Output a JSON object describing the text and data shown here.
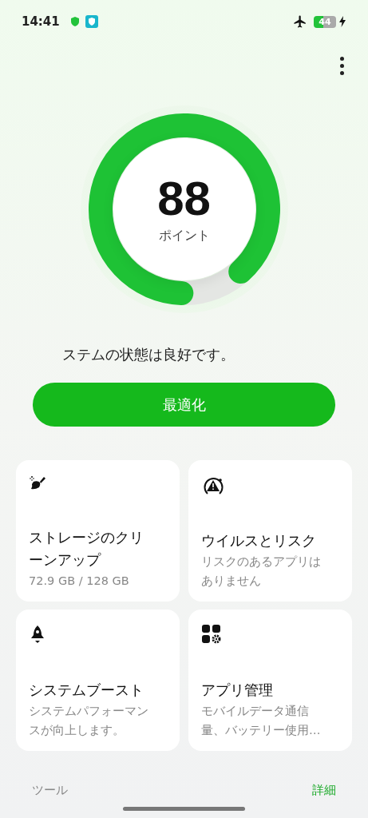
{
  "status_bar": {
    "time": "14:41",
    "battery": "44"
  },
  "score": {
    "value": "88",
    "unit": "ポイント"
  },
  "status_message": "ステムの状態は良好です。",
  "optimize_button": "最適化",
  "cards": [
    {
      "kind": "broom",
      "title": "ストレージのクリーンアップ",
      "subtitle": "72.9 GB / 128 GB"
    },
    {
      "kind": "warning",
      "title": "ウイルスとリスク",
      "subtitle": "リスクのあるアプリはありません"
    },
    {
      "kind": "rocket",
      "title": "システムブースト",
      "subtitle": "システムパフォーマンスが向上します。"
    },
    {
      "kind": "apps",
      "title": "アプリ管理",
      "subtitle": "モバイルデータ通信量、バッテリー使用…"
    }
  ],
  "tabs": [
    {
      "label": "ツール",
      "selected": false
    },
    {
      "label": "詳細",
      "selected": true
    }
  ]
}
